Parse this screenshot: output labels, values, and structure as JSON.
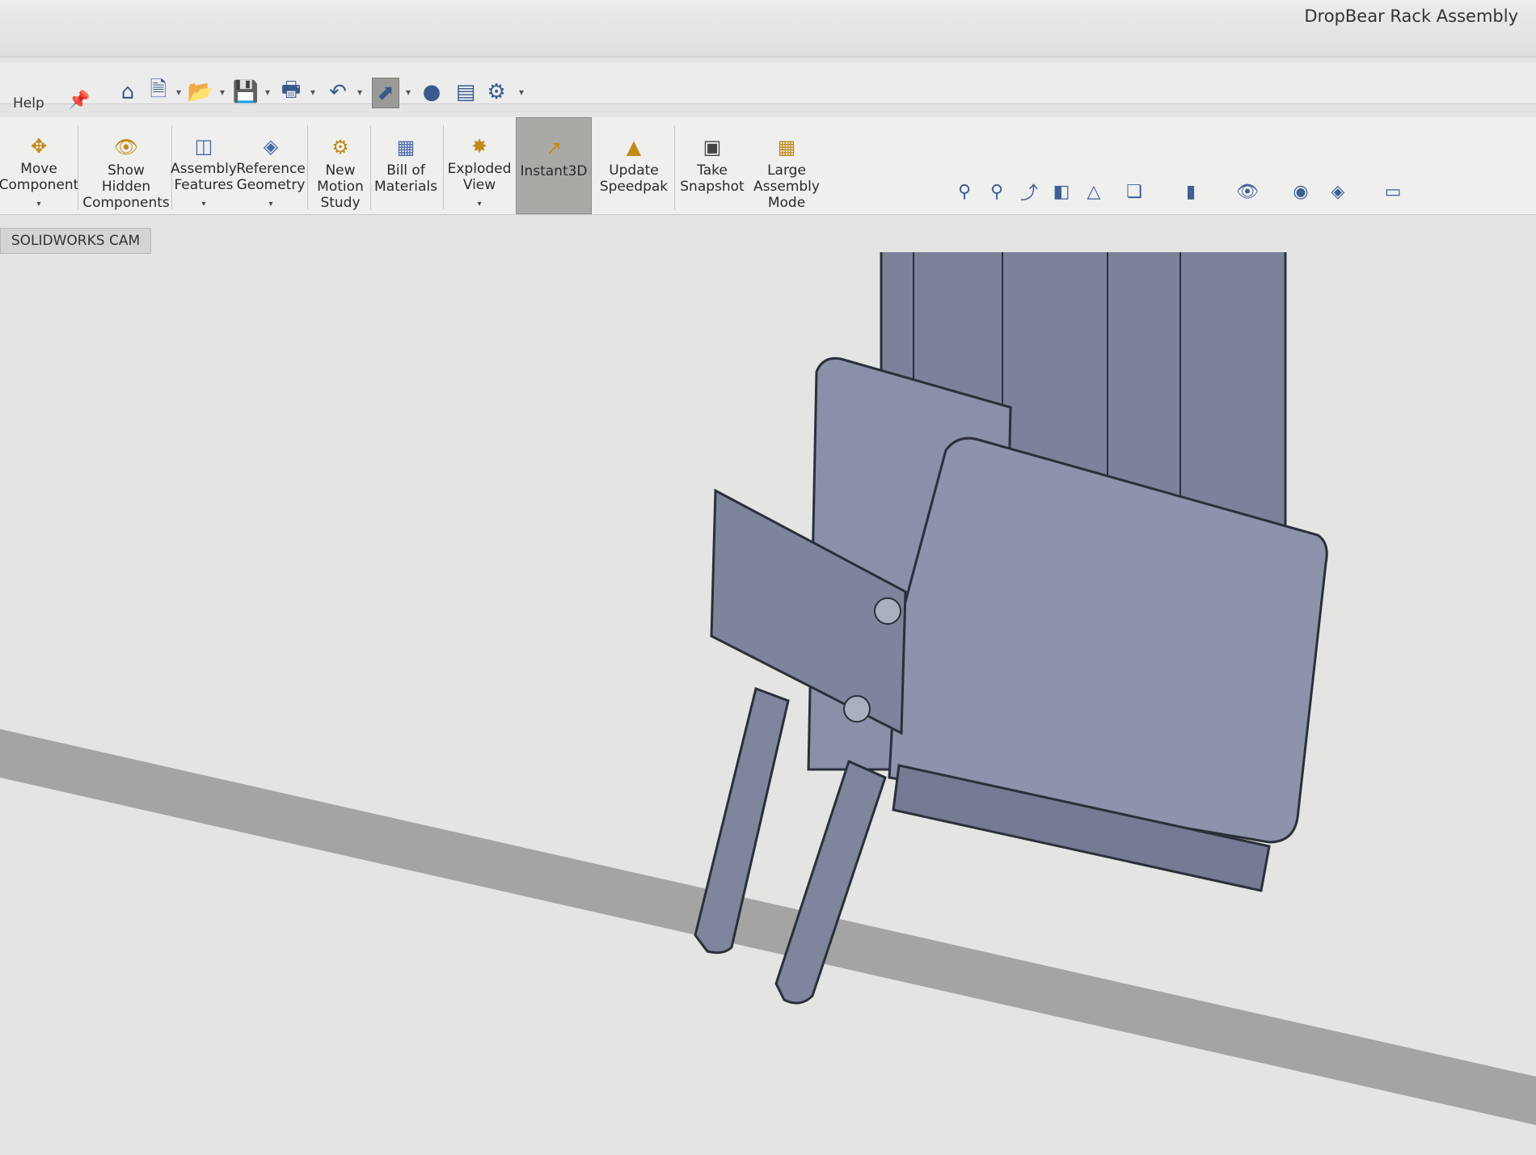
{
  "window": {
    "title": "DropBear Rack Assembly"
  },
  "menu": {
    "help": "Help"
  },
  "quick_access": {
    "icons": [
      "home-icon",
      "new-document-icon",
      "open-icon",
      "save-icon",
      "print-icon",
      "undo-icon",
      "select-icon",
      "rebuild-icon",
      "file-properties-icon",
      "options-icon"
    ]
  },
  "ribbon": {
    "commands": [
      {
        "label": "Move Component",
        "icon": "move-component-icon",
        "dropdown": true
      },
      {
        "label": "Show Hidden Components",
        "icon": "show-hidden-icon",
        "dropdown": false
      },
      {
        "label": "Assembly Features",
        "icon": "assembly-features-icon",
        "dropdown": true
      },
      {
        "label": "Reference Geometry",
        "icon": "reference-geometry-icon",
        "dropdown": true
      },
      {
        "label": "New Motion Study",
        "icon": "motion-study-icon",
        "dropdown": false
      },
      {
        "label": "Bill of Materials",
        "icon": "bom-icon",
        "dropdown": false
      },
      {
        "label": "Exploded View",
        "icon": "exploded-view-icon",
        "dropdown": true
      },
      {
        "label": "Instant3D",
        "icon": "instant3d-icon",
        "dropdown": false,
        "active": true
      },
      {
        "label": "Update Speedpak",
        "icon": "speedpak-icon",
        "dropdown": false
      },
      {
        "label": "Take Snapshot",
        "icon": "camera-icon",
        "dropdown": false
      },
      {
        "label": "Large Assembly Mode",
        "icon": "large-assembly-icon",
        "dropdown": false
      }
    ]
  },
  "tabs": {
    "cam": "SOLIDWORKS CAM"
  },
  "view_toolbar": {
    "icons": [
      "zoom-to-fit-icon",
      "zoom-area-icon",
      "previous-view-icon",
      "section-view-icon",
      "dynamic-annotation-icon",
      "view-orientation-icon",
      "display-style-icon",
      "hide-show-icon",
      "edit-appearance-icon",
      "scenes-icon",
      "view-settings-icon"
    ]
  },
  "colors": {
    "model": "#8a91a8",
    "model_dark": "#6c7389",
    "edges": "#2b2f3a",
    "background": "#e4e4e2"
  }
}
